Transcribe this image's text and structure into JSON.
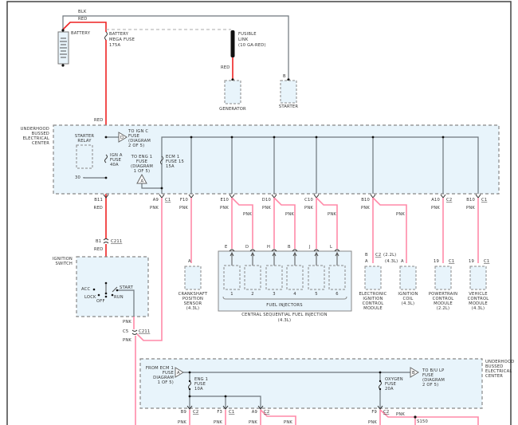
{
  "wire_colors": {
    "red": "#ee2222",
    "pink": "#ff8aa8",
    "black": "#6e767c"
  },
  "wires": {
    "blk": "BLK",
    "red": "RED",
    "pnk": "PNK"
  },
  "battery": {
    "label": "BATTERY"
  },
  "mega_fuse": {
    "l1": "BATTERY",
    "l2": "MEGA FUSE",
    "l3": "175A"
  },
  "fusible_link": {
    "l1": "FUSIBLE",
    "l2": "LINK",
    "l3": "(10 GA-RED)"
  },
  "generator": {
    "label": "GENERATOR"
  },
  "starter": {
    "label": "STARTER",
    "pin": "B"
  },
  "ubec": {
    "l1": "UNDERHOOD",
    "l2": "BUSSED",
    "l3": "ELECTRICAL",
    "l4": "CENTER"
  },
  "starter_relay": {
    "l1": "STARTER",
    "l2": "RELAY",
    "pin": "30"
  },
  "ign_c": {
    "l1": "TO IGN C",
    "l2": "FUSE",
    "l3": "(DIAGRAM",
    "l4": "2 OF 5)",
    "ref": "D"
  },
  "ign_a": {
    "l1": "IGN A",
    "l2": "FUSE",
    "l3": "40A"
  },
  "eng1_ref": {
    "l1": "TO ENG 1",
    "l2": "FUSE",
    "l3": "(DIAGRAM",
    "l4": "1 OF 5)",
    "ref": "A"
  },
  "ecm1": {
    "l1": "ECM 1",
    "l2": "FUSE 15",
    "l3": "15A"
  },
  "pins_top": [
    {
      "pin": "B11",
      "conn": ""
    },
    {
      "pin": "A9",
      "conn": "C1"
    },
    {
      "pin": "F10",
      "conn": ""
    },
    {
      "pin": "E10",
      "conn": ""
    },
    {
      "pin": "D10",
      "conn": ""
    },
    {
      "pin": "C10",
      "conn": ""
    },
    {
      "pin": "B10",
      "conn": ""
    },
    {
      "pin": "A10",
      "conn": "C2"
    },
    {
      "pin": "B10",
      "conn": "C1"
    }
  ],
  "c211_b1": {
    "pin": "B1",
    "conn": "C211"
  },
  "ignition_switch": {
    "l1": "IGNITION",
    "l2": "SWITCH",
    "acc": "ACC",
    "lock": "LOCK",
    "off": "OFF",
    "start": "START",
    "run": "RUN"
  },
  "c211_c5": {
    "pin": "C5",
    "conn": "C211"
  },
  "crank_sensor": {
    "pin": "A",
    "l1": "CRANKSHAFT",
    "l2": "POSITION",
    "l3": "SENSOR",
    "l4": "(4.3L)"
  },
  "injectors": {
    "pins": [
      "E",
      "D",
      "H",
      "B",
      "J",
      "L"
    ],
    "numbers": [
      "1",
      "2",
      "3",
      "4",
      "5",
      "6"
    ],
    "label": "FUEL INJECTORS",
    "caption": "CENTRAL SEQUENTIAL FUEL INJECTION",
    "caption2": "(4.3L)"
  },
  "eicm": {
    "pin_b": "B",
    "pin_a": "A",
    "conn": "C2",
    "note1": "(2.2L)",
    "note2": "(4.3L)",
    "l1": "ELECTRONIC",
    "l2": "IGNITION",
    "l3": "CONTROL",
    "l4": "MODULE"
  },
  "ign_coil": {
    "pin": "A",
    "l1": "IGNITION",
    "l2": "COIL",
    "l3": "(4.3L)"
  },
  "pcm": {
    "pin": "19",
    "conn": "C1",
    "l1": "POWERTRAIN",
    "l2": "CONTROL",
    "l3": "MODULE",
    "l4": "(2.2L)"
  },
  "vcm": {
    "pin": "19",
    "conn": "C1",
    "l1": "VEHICLE",
    "l2": "CONTROL",
    "l3": "MODULE",
    "l4": "(4.3L)"
  },
  "ubec2": {
    "from_l1": "FROM ECM 1",
    "from_l2": "FUSE",
    "from_l3": "DIAGRAM",
    "from_l4": "1 OF 5)",
    "from_ref": "A",
    "eng1_l1": "ENG 1",
    "eng1_l2": "FUSE",
    "eng1_l3": "10A",
    "oxy_l1": "OXYGEN",
    "oxy_l2": "FUSE",
    "oxy_l3": "20A",
    "to_l1": "TO B/U LP",
    "to_l2": "FUSE",
    "to_l3": "(DIAGRAM",
    "to_l4": "2 OF 5)",
    "to_ref": "B",
    "pins": [
      {
        "pin": "B9",
        "conn": "C2"
      },
      {
        "pin": "F3",
        "conn": "C1"
      },
      {
        "pin": "A9",
        "conn": "C2"
      },
      {
        "pin": "F9",
        "conn": "C2"
      }
    ],
    "splice": "S150"
  }
}
